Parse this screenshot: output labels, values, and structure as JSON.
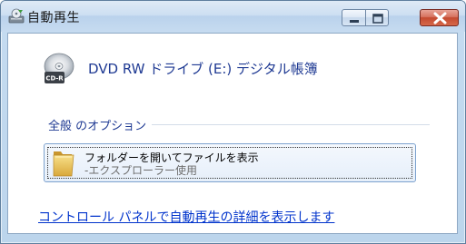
{
  "window": {
    "title": "自動再生",
    "minimize_icon": "minimize-icon",
    "maximize_icon": "maximize-icon",
    "close_icon": "close-icon"
  },
  "device": {
    "icon": "cd-r-disc-icon",
    "icon_badge": "CD-R",
    "label": "DVD RW ドライブ (E:) デジタル帳簿"
  },
  "general_options": {
    "title": "全般 のオプション",
    "options": [
      {
        "icon": "folder-icon",
        "label": "フォルダーを開いてファイルを表示",
        "sublabel": "-エクスプローラー使用"
      }
    ]
  },
  "footer": {
    "link": "コントロール パネルで自動再生の詳細を表示します"
  },
  "colors": {
    "link": "#0033cc",
    "heading": "#1f3a93",
    "close_button": "#c44a30",
    "titlebar": "#c6dbf0"
  }
}
